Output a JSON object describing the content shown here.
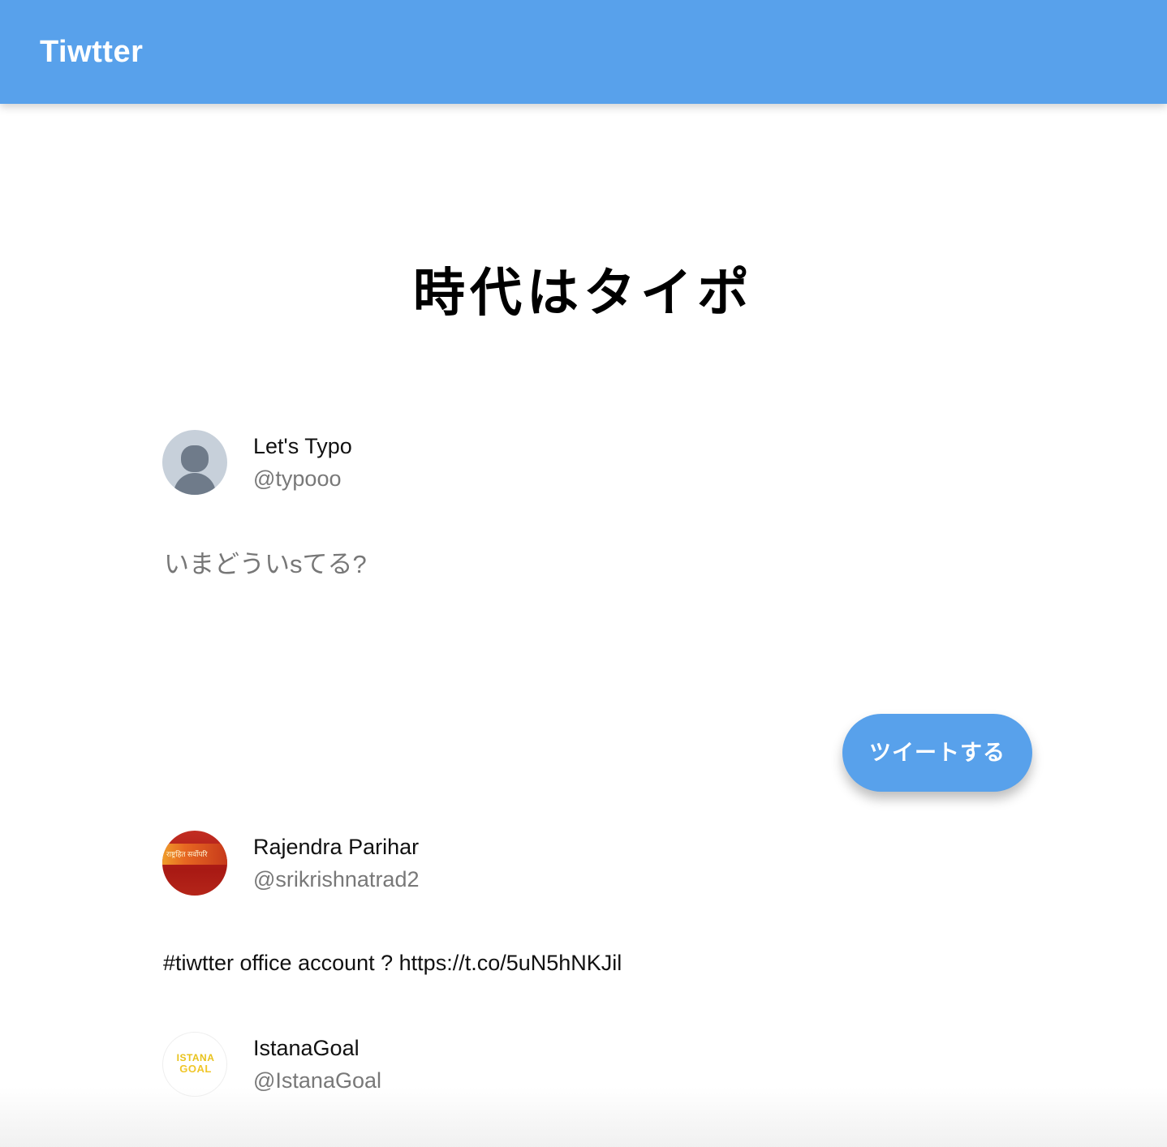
{
  "app_bar": {
    "title": "Tiwtter",
    "color": "#58a1eb"
  },
  "hero": {
    "title": "時代はタイポ"
  },
  "composer": {
    "user": {
      "name": "Let's Typo",
      "handle": "@typooo",
      "avatar_icon": "default-user-icon"
    },
    "input": {
      "value": "",
      "placeholder": "いまどういsてる?"
    },
    "button_label": "ツイートする"
  },
  "tweets": [
    {
      "name": "Rajendra Parihar",
      "handle": "@srikrishnatrad2",
      "avatar": {
        "type": "red-banner-avatar",
        "text": "राष्ट्रहित सर्वोपरि"
      },
      "text": "#tiwtter office account ? https://t.co/5uN5hNKJil"
    },
    {
      "name": "IstanaGoal",
      "handle": "@IstanaGoal",
      "avatar": {
        "type": "istana-goal-logo",
        "line1": "ISTANA",
        "line2": "GOAL"
      }
    }
  ]
}
